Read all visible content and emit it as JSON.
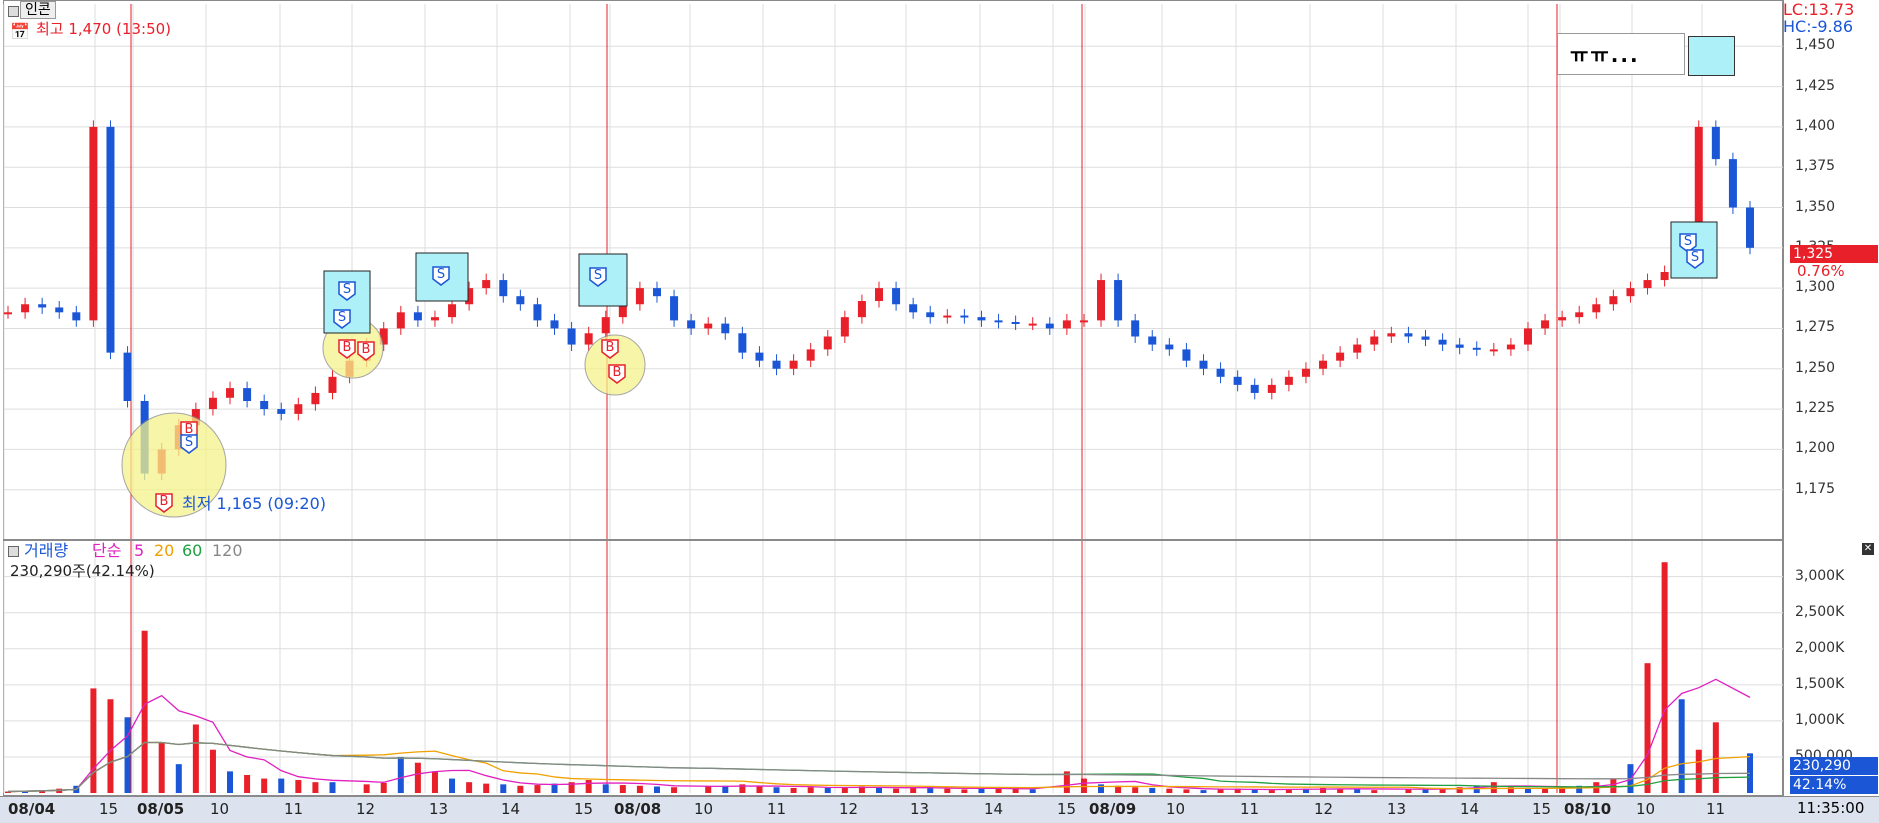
{
  "price_pane": {
    "stock_name": "인콘",
    "high_label": "최고 1,470 (13:50)",
    "low_label": "최저 1,165 (09:20)",
    "lc_label": "LC:13.73",
    "hc_label": "HC:-9.86",
    "current_price": "1,325",
    "current_change": "0.76%",
    "memo_text": "ㅠㅠ...",
    "y_ticks": [
      "1,450",
      "1,425",
      "1,400",
      "1,375",
      "1,350",
      "1,325",
      "1,300",
      "1,275",
      "1,250",
      "1,225",
      "1,200",
      "1,175"
    ],
    "buy_marker": "B",
    "sell_marker": "S"
  },
  "volume_pane": {
    "title": "거래량",
    "ma_label": "단순",
    "ma_periods": [
      "5",
      "20",
      "60",
      "120"
    ],
    "volume_text": "230,290주(42.14%)",
    "current_volume": "230,290",
    "current_pct": "42.14%",
    "y_ticks": [
      "3,000K",
      "2,500K",
      "2,000K",
      "1,500K",
      "1,000K",
      "500,000"
    ]
  },
  "x_axis": {
    "labels": [
      {
        "t": "08/04",
        "bold": true
      },
      {
        "t": "15",
        "bold": false
      },
      {
        "t": "08/05",
        "bold": true
      },
      {
        "t": "10",
        "bold": false
      },
      {
        "t": "11",
        "bold": false
      },
      {
        "t": "12",
        "bold": false
      },
      {
        "t": "13",
        "bold": false
      },
      {
        "t": "14",
        "bold": false
      },
      {
        "t": "15",
        "bold": false
      },
      {
        "t": "08/08",
        "bold": true
      },
      {
        "t": "10",
        "bold": false
      },
      {
        "t": "11",
        "bold": false
      },
      {
        "t": "12",
        "bold": false
      },
      {
        "t": "13",
        "bold": false
      },
      {
        "t": "14",
        "bold": false
      },
      {
        "t": "15",
        "bold": false
      },
      {
        "t": "08/09",
        "bold": true
      },
      {
        "t": "10",
        "bold": false
      },
      {
        "t": "11",
        "bold": false
      },
      {
        "t": "12",
        "bold": false
      },
      {
        "t": "13",
        "bold": false
      },
      {
        "t": "14",
        "bold": false
      },
      {
        "t": "15",
        "bold": false
      },
      {
        "t": "08/10",
        "bold": true
      },
      {
        "t": "10",
        "bold": false
      },
      {
        "t": "11",
        "bold": false
      }
    ],
    "time": "11:35:00"
  },
  "colors": {
    "up": "#e8202a",
    "down": "#1a56d6",
    "ma5": "#e020c0",
    "ma20": "#f0a000",
    "ma60": "#20a040",
    "ma120": "#888888",
    "grid": "#dddddd"
  },
  "chart_data": {
    "type": "candlestick",
    "price_range": [
      1150,
      1470
    ],
    "volume_range": [
      0,
      3300
    ],
    "volume_unit": "K",
    "close_path": [
      1285,
      1290,
      1288,
      1285,
      1280,
      1400,
      1260,
      1230,
      1185,
      1200,
      1215,
      1225,
      1232,
      1238,
      1230,
      1225,
      1222,
      1228,
      1235,
      1245,
      1255,
      1265,
      1275,
      1285,
      1280,
      1282,
      1290,
      1300,
      1305,
      1295,
      1290,
      1280,
      1275,
      1265,
      1272,
      1282,
      1290,
      1300,
      1295,
      1280,
      1275,
      1278,
      1272,
      1260,
      1255,
      1250,
      1255,
      1262,
      1270,
      1282,
      1292,
      1300,
      1290,
      1285,
      1282,
      1283,
      1282,
      1280,
      1279,
      1278,
      1278,
      1275,
      1280,
      1280,
      1305,
      1280,
      1270,
      1265,
      1262,
      1255,
      1250,
      1245,
      1240,
      1235,
      1240,
      1245,
      1250,
      1255,
      1260,
      1265,
      1270,
      1272,
      1270,
      1268,
      1265,
      1263,
      1262,
      1262,
      1265,
      1275,
      1280,
      1282,
      1285,
      1290,
      1295,
      1300,
      1305,
      1310,
      1330,
      1400,
      1380,
      1350,
      1325
    ],
    "volume_path": [
      20,
      30,
      40,
      60,
      100,
      1450,
      1300,
      1050,
      2250,
      700,
      400,
      950,
      600,
      300,
      250,
      200,
      200,
      180,
      150,
      150,
      120,
      140,
      500,
      420,
      300,
      200,
      150,
      130,
      120,
      100,
      110,
      130,
      150,
      180,
      120,
      110,
      100,
      90,
      80,
      90,
      100,
      120,
      90,
      80,
      70,
      80,
      70,
      80,
      90,
      70,
      60,
      70,
      80,
      60,
      50,
      60,
      70,
      60,
      50,
      300,
      200,
      120,
      100,
      80,
      70,
      60,
      50,
      40,
      50,
      60,
      50,
      40,
      50,
      60,
      70,
      60,
      50,
      40,
      50,
      60,
      70,
      80,
      100,
      150,
      80,
      70,
      60,
      80,
      100,
      150,
      200,
      400,
      1800,
      3200,
      1300,
      600,
      980,
      550
    ]
  }
}
